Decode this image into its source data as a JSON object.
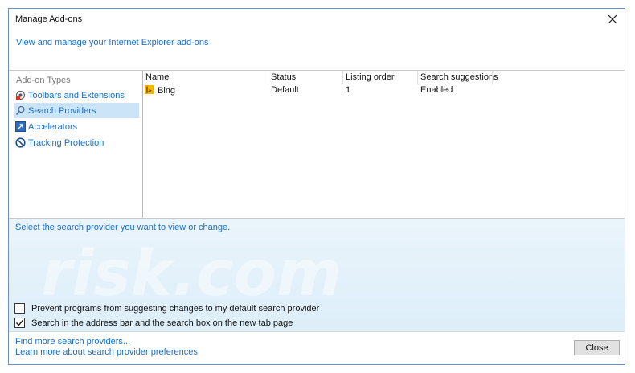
{
  "window": {
    "title": "Manage Add-ons",
    "header_link": "View and manage your Internet Explorer add-ons"
  },
  "addon_types": {
    "label": "Add-on Types",
    "items": [
      {
        "label": "Toolbars and Extensions",
        "icon": "gear-icon"
      },
      {
        "label": "Search Providers",
        "icon": "search-icon",
        "selected": true
      },
      {
        "label": "Accelerators",
        "icon": "accelerator-icon"
      },
      {
        "label": "Tracking Protection",
        "icon": "no-entry-icon"
      }
    ]
  },
  "list": {
    "columns": [
      "Name",
      "Status",
      "Listing order",
      "Search suggestions"
    ],
    "rows": [
      {
        "name": "Bing",
        "status": "Default",
        "listing_order": "1",
        "search_suggestions": "Enabled"
      }
    ]
  },
  "details": {
    "prompt": "Select the search provider you want to view or change.",
    "checkboxes": [
      {
        "label": "Prevent programs from suggesting changes to my default search provider",
        "checked": false
      },
      {
        "label": "Search in the address bar and the search box on the new tab page",
        "checked": true
      }
    ]
  },
  "footer": {
    "link_find": "Find more search providers...",
    "link_learn": "Learn more about search provider preferences",
    "close_label": "Close"
  },
  "colors": {
    "link": "#1a6fc4",
    "selection": "#cce4f7",
    "details_bg": "#e4f1fa"
  }
}
